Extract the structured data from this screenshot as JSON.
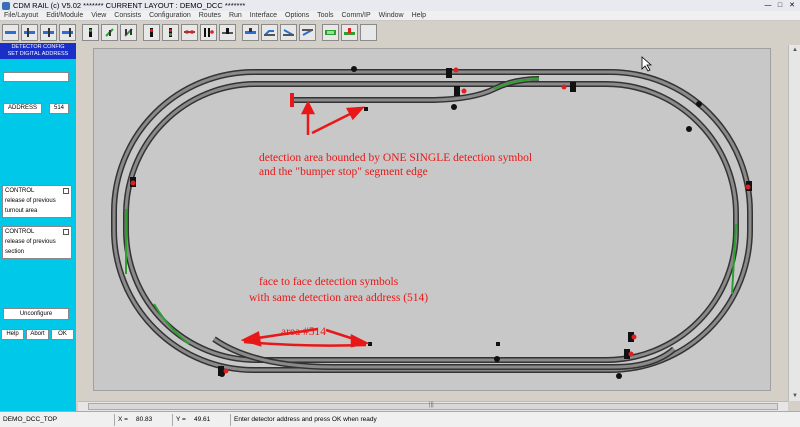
{
  "window": {
    "title": "CDM RAIL (c) V5.02    ******* CURRENT LAYOUT : DEMO_DCC *******",
    "minimize": "—",
    "maximize": "□",
    "close": "✕"
  },
  "menu": [
    "File/Layout",
    "Edit/Module",
    "View",
    "Consists",
    "Configuration",
    "Routes",
    "Run",
    "Interface",
    "Options",
    "Tools",
    "Comm/IP",
    "Window",
    "Help"
  ],
  "toolbar": {
    "buttons": [
      "track-straight",
      "track-curve",
      "turnout",
      "crossing",
      "signal-green",
      "signal-dual",
      "signal-red",
      "signal-aspect",
      "detector",
      "detector-face",
      "detector-multi",
      "detector-address",
      "bumper-stop",
      "sign-board",
      "route-set",
      "route-exit",
      "occupancy",
      "timer",
      "blank"
    ]
  },
  "panel": {
    "header_line1": "DETECTOR CONFIG",
    "header_line2": "SET DIGITAL ADDRESS",
    "address_label": "ADDRESS",
    "address_value": "514",
    "control1_title": "CONTROL",
    "control1_line2": "release of previous",
    "control1_line3": "turnout area",
    "control2_title": "CONTROL",
    "control2_line2": "release of previous",
    "control2_line3": "section",
    "unconfigure": "Unconfigure",
    "help": "Help",
    "abort": "Abort",
    "ok": "OK"
  },
  "annotations": {
    "note1_line1": "detection area bounded by ONE SINGLE detection symbol",
    "note1_line2": "and the \"bumper stop\" segment edge",
    "note2_line1": "face to face detection symbols",
    "note2_line2": "with same detection area address (514)",
    "area_label": "area #514"
  },
  "colors": {
    "annotation": "#e81818",
    "track_active": "#2ca02c",
    "panel_bg": "#00c8e8",
    "panel_header": "#1a2fc8"
  },
  "status": {
    "layout": "DEMO_DCC_TOP",
    "x_label": "X =",
    "x_value": "80.83",
    "y_label": "Y =",
    "y_value": "49.61",
    "message": "Enter detector address and press OK when ready"
  },
  "scroll": {
    "up": "▲",
    "down": "▼",
    "grip": "|||"
  }
}
